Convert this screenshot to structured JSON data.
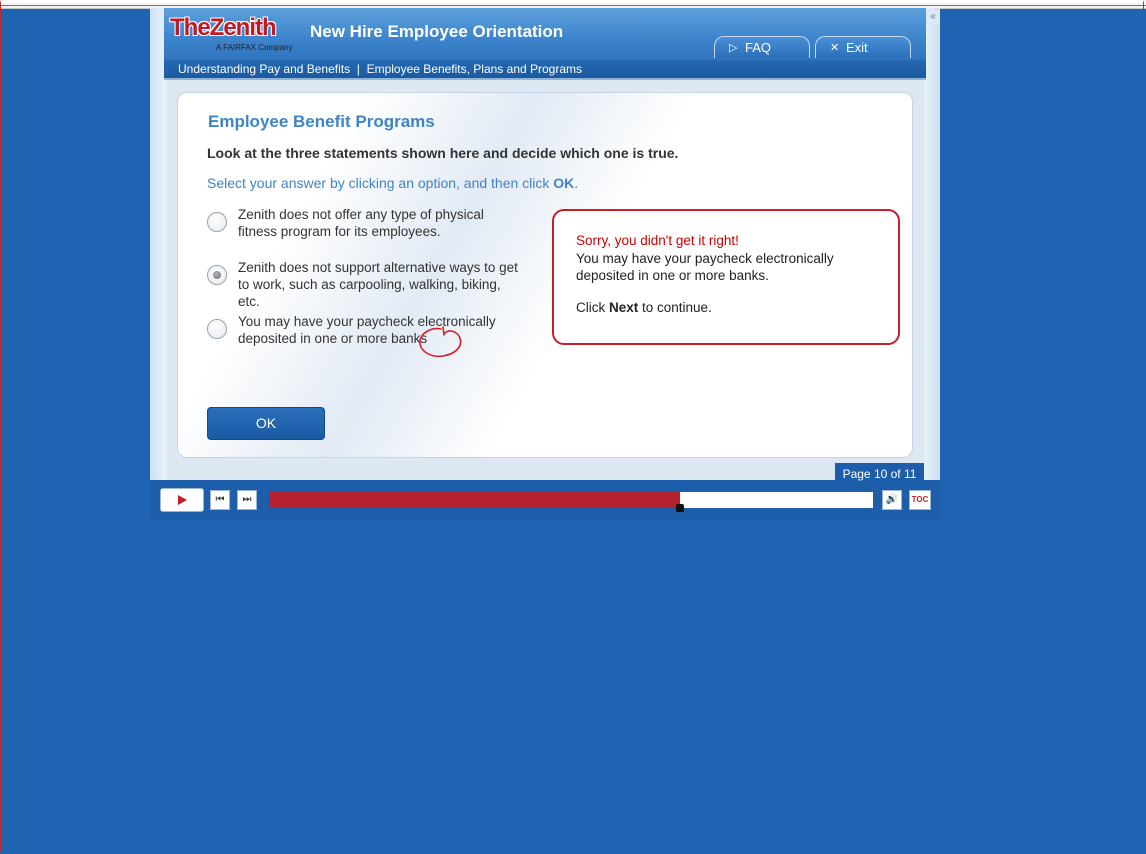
{
  "app": {
    "logo_text": "TheZenith",
    "logo_sub": "A FAIRFAX Company",
    "title": "New Hire Employee Orientation",
    "collapse_glyph": "«"
  },
  "nav": {
    "faq_label": "FAQ",
    "exit_label": "Exit"
  },
  "breadcrumb": "Understanding Pay and Benefits  |  Employee Benefits, Plans and Programs",
  "main": {
    "title": "Employee Benefit Programs",
    "question": "Look at the three statements shown here and decide which one is true.",
    "instruction_prefix": "Select your answer by clicking an option, and then click ",
    "instruction_ok": "OK",
    "instruction_suffix": ".",
    "options": [
      {
        "text": "Zenith does not offer any type of physical fitness program for its employees.",
        "selected": false
      },
      {
        "text": "Zenith does not support alternative ways to get to work, such as carpooling, walking, biking, etc.",
        "selected": true
      },
      {
        "text": "You may have your paycheck electronically deposited in one or more banks",
        "selected": false
      }
    ],
    "ok_label": "OK"
  },
  "feedback": {
    "sorry": "Sorry, you didn't get it right!",
    "body": "You may have your paycheck electronically deposited in one or more banks.",
    "next_prefix": "Click ",
    "next_word": "Next",
    "next_suffix": " to continue."
  },
  "player": {
    "page_label": "Page 10 of 11",
    "progress_fraction": 0.68,
    "toc_label": "TOC"
  },
  "colors": {
    "background": "#1e64b2",
    "accent_red": "#c81e2a",
    "title_blue": "#3f84c5"
  }
}
